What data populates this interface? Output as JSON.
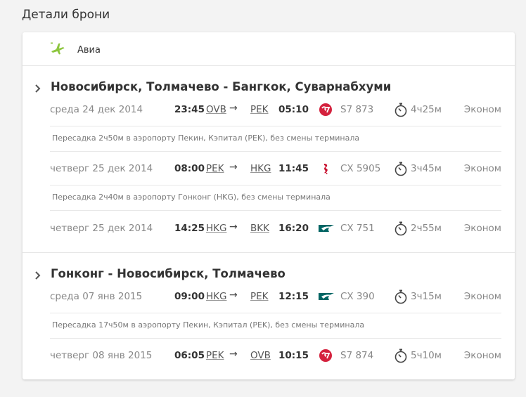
{
  "page": {
    "title": "Детали брони"
  },
  "header": {
    "label": "Авиа",
    "icon": "plane-icon",
    "accent": "#8dc63f"
  },
  "routes": [
    {
      "title": "Новосибирск, Толмачево - Бангкок, Суварнабхуми",
      "segments": [
        {
          "date": "среда 24 дек 2014",
          "dep_time": "23:45",
          "dep_code": "OVB",
          "arr_code": "PEK",
          "arr_time": "05:10",
          "airline": "s7",
          "flight": "S7 873",
          "duration": "4ч25м",
          "cabin": "Эконом"
        },
        {
          "date": "четверг 25 дек 2014",
          "dep_time": "08:00",
          "dep_code": "PEK",
          "arr_code": "HKG",
          "arr_time": "11:45",
          "airline": "dragonair",
          "flight": "CX 5905",
          "duration": "3ч45м",
          "cabin": "Эконом"
        },
        {
          "date": "четверг 25 дек 2014",
          "dep_time": "14:25",
          "dep_code": "HKG",
          "arr_code": "BKK",
          "arr_time": "16:20",
          "airline": "cathay",
          "flight": "CX 751",
          "duration": "2ч55м",
          "cabin": "Эконом"
        }
      ],
      "transfers": [
        "Пересадка 2ч50м в аэропорту Пекин, Кэпитал (PEK), без смены терминала",
        "Пересадка 2ч40м в аэропорту Гонконг (HKG), без смены терминала"
      ]
    },
    {
      "title": "Гонконг - Новосибирск, Толмачево",
      "segments": [
        {
          "date": "среда 07 янв 2015",
          "dep_time": "09:00",
          "dep_code": "HKG",
          "arr_code": "PEK",
          "arr_time": "12:15",
          "airline": "cathay",
          "flight": "CX 390",
          "duration": "3ч15м",
          "cabin": "Эконом"
        },
        {
          "date": "четверг 08 янв 2015",
          "dep_time": "06:05",
          "dep_code": "PEK",
          "arr_code": "OVB",
          "arr_time": "10:15",
          "airline": "s7",
          "flight": "S7 874",
          "duration": "5ч10м",
          "cabin": "Эконом"
        }
      ],
      "transfers": [
        "Пересадка 17ч50м в аэропорту Пекин, Кэпитал (PEK), без смены терминала"
      ]
    }
  ],
  "arrow_glyph": "→",
  "colors": {
    "s7": "#d4213d",
    "cathay": "#006564",
    "dragonair": "#c8102e"
  }
}
